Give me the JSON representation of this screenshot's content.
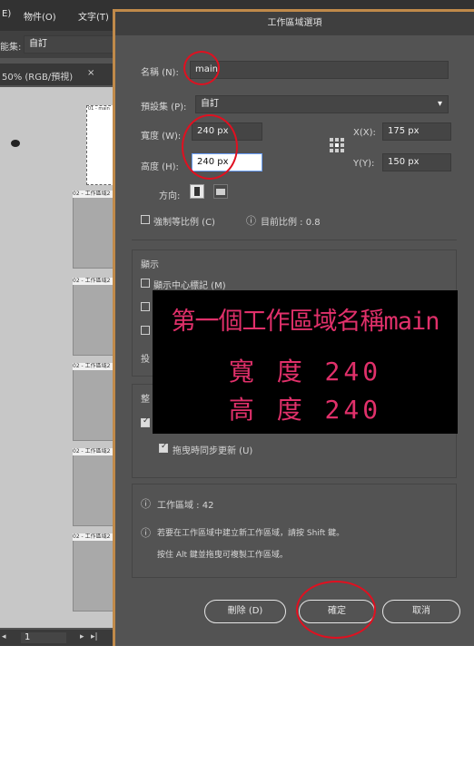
{
  "menubar": {
    "items": [
      "E)",
      "物件(O)",
      "文字(T)"
    ]
  },
  "controlbar": {
    "label": "能集:",
    "value": "自訂"
  },
  "document_tab": {
    "title": "50% (RGB/預視)",
    "close": "×"
  },
  "artboards": {
    "label_short": "01 - main",
    "label_generic": "02 - 工作區域2"
  },
  "statusbar": {
    "page": "1"
  },
  "dialog": {
    "title": "工作區域選項",
    "name_label": "名稱 (N):",
    "name_value": "main",
    "preset_label": "預設集 (P):",
    "preset_value": "自訂",
    "width_label": "寬度 (W):",
    "width_value": "240 px",
    "height_label": "高度 (H):",
    "height_value": "240 px",
    "x_label": "X(X):",
    "x_value": "175 px",
    "y_label": "Y(Y):",
    "y_value": "150 px",
    "orientation_label": "方向:",
    "constrain_label": "強制等比例 (C)",
    "current_ratio": "目前比例 : 0.8",
    "display_section": "顯示",
    "show_center_mark": "顯示中心標記 (M)",
    "partial_label_tou": "投",
    "partial_label_zheng": "整",
    "update_while_dragging": "拖曳時同步更新 (U)",
    "artboard_count": "工作區域 : 42",
    "tip_line1": "若要在工作區域中建立新工作區域，請按 Shift 鍵。",
    "tip_line2": "按住 Alt 鍵並拖曳可複製工作區域。",
    "delete_button": "刪除 (D)",
    "ok_button": "確定",
    "cancel_button": "取消"
  },
  "overlay": {
    "line1": "第一個工作區域名稱main",
    "line2": "寬 度 240",
    "line3": "高 度 240"
  },
  "colors": {
    "annotation_red": "#e01020",
    "overlay_text": "#e0306a",
    "dialog_border": "#c08a4a"
  }
}
